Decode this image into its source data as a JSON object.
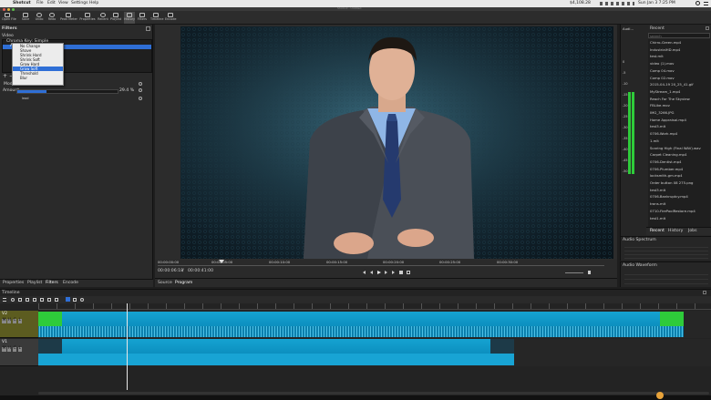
{
  "mac_menubar": {
    "app": "Shotcut",
    "menus": [
      "File",
      "Edit",
      "View",
      "Settings",
      "Help"
    ],
    "right_status": "$4,108.28",
    "clock": "Sun Jan 3  7:25 PM"
  },
  "window_title": "Shotcut - Untitled",
  "toolbar": {
    "buttons": [
      "Open File",
      "Save",
      "Undo",
      "Redo",
      "Peak Meter",
      "Properties",
      "Recent",
      "Playlist",
      "History",
      "Filters",
      "Timeline",
      "Encode"
    ]
  },
  "filters_panel": {
    "title": "Filters",
    "section": "Video",
    "items": [
      "Chroma Key: Simple",
      "Alpha"
    ],
    "mode_label": "Mode",
    "amount_label": "Amount",
    "amount_value": "29.4 %",
    "amount_fraction": 0.294,
    "extra_label": "lead",
    "dropdown_options": [
      "No Change",
      "Shave",
      "Shrink Hard",
      "Shrink Soft",
      "Grow Hard",
      "Grow Soft",
      "Threshold",
      "Blur"
    ],
    "dropdown_selected_index": 5
  },
  "bottom_tabs": [
    "Properties",
    "Playlist",
    "Filters",
    "Encode"
  ],
  "player": {
    "ruler_ticks": [
      "00:00:00:00",
      "00:00:05:00",
      "00:00:10:00",
      "00:00:15:00",
      "00:00:20:00",
      "00:00:25:00",
      "00:00:30:00"
    ],
    "current_timecode": "00:00:06:18",
    "total_timecode": "00:00:41:00",
    "tabs": [
      "Source",
      "Program"
    ]
  },
  "right_panel": {
    "audio_label": "Audi...",
    "recent_title": "Recent",
    "search_placeholder": "search",
    "vu_scale": [
      "0",
      "-5",
      "-10",
      "-15",
      "-20",
      "-25",
      "-30",
      "-35",
      "-40",
      "-45",
      "-50"
    ],
    "files": [
      "Chirro-Green.mp4",
      "IndustrialHD.mp4",
      "test.mlt",
      "video (1).mov",
      "Comp 04.mov",
      "Comp 02.mov",
      "2015-04-19 20_25_41.gif",
      "MyStream_1.mp4",
      "Reach For The Skyview",
      "FBLike.mov",
      "IMG_3266.JPG",
      "Home Appraisal.mp4",
      "test3.mlt",
      "0706-Work.mp4",
      "1.mlt",
      "Scaring High (Final WAV).wav",
      "Carpet Cleaning.mp4",
      "0706-Dentist.mp4",
      "0706-Plumber.mp4",
      "locksmith-gm.mp4",
      "Order button 08 275.png",
      "test3.mlt",
      "0706-Bankruptcy.mp4",
      "trans.mlt",
      "0710-FirePoolRestore.mp4",
      "test1.mlt"
    ],
    "tabs": [
      "Recent",
      "History",
      "Jobs"
    ],
    "spectrum_title": "Audio Spectrum",
    "waveform_title": "Audio Waveform"
  },
  "timeline": {
    "title": "Timeline",
    "tracks": [
      {
        "name": "V2",
        "buttons": [
          "M",
          "H",
          "C",
          "L"
        ]
      },
      {
        "name": "V1",
        "buttons": [
          "M",
          "H",
          "C",
          "L"
        ]
      }
    ]
  },
  "colors": {
    "accent": "#2f6fd6",
    "clip": "#15a3d1",
    "green": "#2ecb3a"
  }
}
